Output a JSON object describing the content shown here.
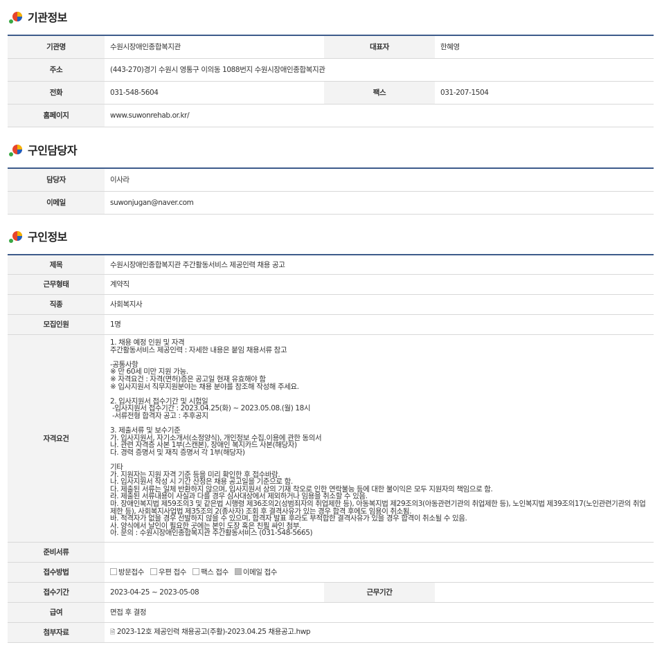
{
  "sections": {
    "org": "기관정보",
    "contact": "구인담당자",
    "job": "구인정보"
  },
  "org": {
    "name_label": "기관명",
    "name": "수원시장애인종합복지관",
    "rep_label": "대표자",
    "rep": "한혜영",
    "addr_label": "주소",
    "addr": "(443-270)경기 수원시 영통구 이의동 1088번지 수원시장애인종합복지관",
    "tel_label": "전화",
    "tel": "031-548-5604",
    "fax_label": "팩스",
    "fax": "031-207-1504",
    "home_label": "홈페이지",
    "home": "www.suwonrehab.or.kr/"
  },
  "contact": {
    "person_label": "담당자",
    "person": "이사라",
    "email_label": "이메일",
    "email": "suwonjugan@naver.com"
  },
  "job": {
    "title_label": "제목",
    "title": "수원시장애인종합복지관 주간활동서비스 제공인력 채용 공고",
    "type_label": "근무형태",
    "type": "계약직",
    "field_label": "직종",
    "field": "사회복지사",
    "count_label": "모집인원",
    "count": "1명",
    "qual_label": "자격요건",
    "qual": "1. 채용 예정 인원 및 자격\n주간활동서비스 제공인력 : 자세한 내용은 붙임 채용서류 참고\n\n-공통사항\n※ 만 60세 미만 지원 가능.\n※ 자격요건 : 자격(면허)증은 공고일 현재 유효해야 함\n※ 입사지원서 직무지원분야는 채용 분야를 참조해 작성해 주세요.\n\n2. 입사지원서 접수기간 및 시험일\n -입사지원서 접수기간 : 2023.04.25(화) ~ 2023.05.08.(월) 18시\n -서류전형 합격자 공고 : 추후공지\n\n3. 제출서류 및 보수기준\n가. 입사지원서, 자기소개서(소정양식), 개인정보 수집.이용에 관한 동의서\n나. 관련 자격증 사본 1부(스캔본), 장애인 복지카드 사본(해당자)\n다. 경력 증명서 및 재직 증명서 각 1부(해당자)\n\n기타\n가. 지원자는 지원 자격 기준 등을 미리 확인한 후 접수바람.\n나. 입사지원서 작성 시 기간 산정은 채용 공고일을 기준으로 함.\n다. 제출된 서류는 일체 반환하지 않으며, 입사지원서 상의 기재 착오로 인한 연락불능 등에 대한 불이익은 모두 지원자의 책임으로 함.\n라. 제출된 서류내용이 사실과 다를 경우 심사대상에서 제외하거나 임용을 취소할 수 있음.\n마. 장애인복지법 제59조의3 및 같은법 시행령 제36조의2(성범죄자의 취업제한 등), 아동복지법 제29조의3(아동관련기관의 취업제한 등), 노인복지법 제39조의17(노인관련기관의 취업제한 등), 사회복지사업법 제35조의 2(종사자) 조회 후 결격사유가 있는 경우 합격 후에도 임용이 취소됨.\n바. 적격자가 없을 경우 선발하지 않을 수 있으며, 합격자 발표 후라도 부적합한 결격사유가 있을 경우 합격이 취소될 수 있음.\n사. 양식에서 날인이 필요한 곳에는 본인 도장 혹은 친필 싸인 첨부.\n아. 문의 : 수원시장애인종합복지관 주간활동서비스 (031-548-5665)",
    "docs_label": "준비서류",
    "docs": "",
    "method_label": "접수방법",
    "methods": [
      {
        "label": "방문접수",
        "checked": false
      },
      {
        "label": "우편 접수",
        "checked": false
      },
      {
        "label": "팩스 접수",
        "checked": false
      },
      {
        "label": "이메일 접수",
        "checked": true
      }
    ],
    "period_label": "접수기간",
    "period": "2023-04-25 ~ 2023-05-08",
    "workhours_label": "근무기간",
    "workhours": "",
    "salary_label": "급여",
    "salary": "면접 후 결정",
    "attach_label": "첨부자료",
    "attach": "2023-12호 제공인력 채용공고(주활)-2023.04.25 채용공고.hwp"
  },
  "icons": {
    "logo": "multicolor-dot-logo-icon",
    "file": "file-icon"
  },
  "colors": {
    "table_top_border": "#3c5a8a",
    "header_bg": "#f3f3f3"
  }
}
